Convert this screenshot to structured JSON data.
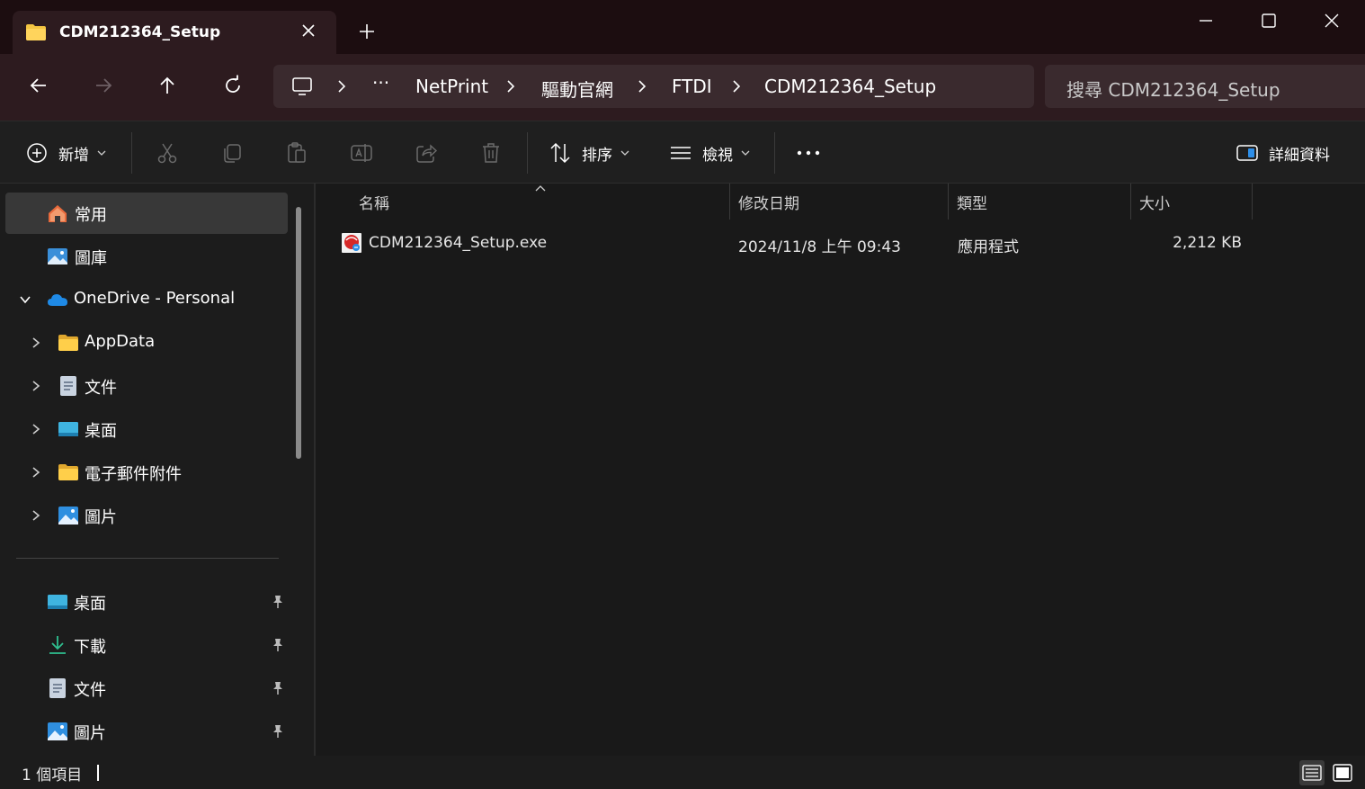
{
  "window": {
    "tab_title": "CDM212364_Setup",
    "icons": {
      "tab": "folder-icon",
      "close_tab": "close-icon",
      "new_tab": "plus-icon",
      "minimize": "minimize-icon",
      "maximize": "maximize-icon",
      "close": "close-icon"
    }
  },
  "nav": {
    "icons": [
      "back-arrow-icon",
      "forward-arrow-icon",
      "up-arrow-icon",
      "refresh-icon"
    ],
    "breadcrumb": {
      "root_icon": "monitor-icon",
      "overflow": "···",
      "items": [
        "NetPrint",
        "驅動官網",
        "FTDI",
        "CDM212364_Setup"
      ]
    },
    "search_placeholder": "搜尋 CDM212364_Setup"
  },
  "toolbar": {
    "new_label": "新增",
    "sort_label": "排序",
    "view_label": "檢視",
    "more_label": "···",
    "details_label": "詳細資料",
    "action_icons": [
      "cut-icon",
      "copy-icon",
      "paste-icon",
      "rename-icon",
      "share-icon",
      "delete-icon"
    ]
  },
  "sidebar": {
    "items": [
      {
        "label": "常用",
        "icon": "home-icon"
      },
      {
        "label": "圖庫",
        "icon": "gallery-icon"
      },
      {
        "label": "OneDrive - Personal",
        "icon": "cloud-icon"
      },
      {
        "label": "AppData",
        "icon": "folder-icon"
      },
      {
        "label": "文件",
        "icon": "document-icon"
      },
      {
        "label": "桌面",
        "icon": "desktop-icon"
      },
      {
        "label": "電子郵件附件",
        "icon": "folder-icon"
      },
      {
        "label": "圖片",
        "icon": "pictures-icon"
      }
    ],
    "pinned": [
      {
        "label": "桌面",
        "icon": "desktop-icon"
      },
      {
        "label": "下載",
        "icon": "download-icon"
      },
      {
        "label": "文件",
        "icon": "document-icon"
      },
      {
        "label": "圖片",
        "icon": "pictures-icon"
      }
    ]
  },
  "filelist": {
    "columns": [
      "名稱",
      "修改日期",
      "類型",
      "大小"
    ],
    "rows": [
      {
        "name": "CDM212364_Setup.exe",
        "modified": "2024/11/8 上午 09:43",
        "type": "應用程式",
        "size": "2,212 KB"
      }
    ]
  },
  "status": {
    "count_text": "1 個項目",
    "colors": {
      "background": "#191919",
      "titlebar": "#1c0d10",
      "navbar": "#2d1b1f",
      "folder": "#f4c542",
      "accent": "#2d8ee8"
    }
  }
}
